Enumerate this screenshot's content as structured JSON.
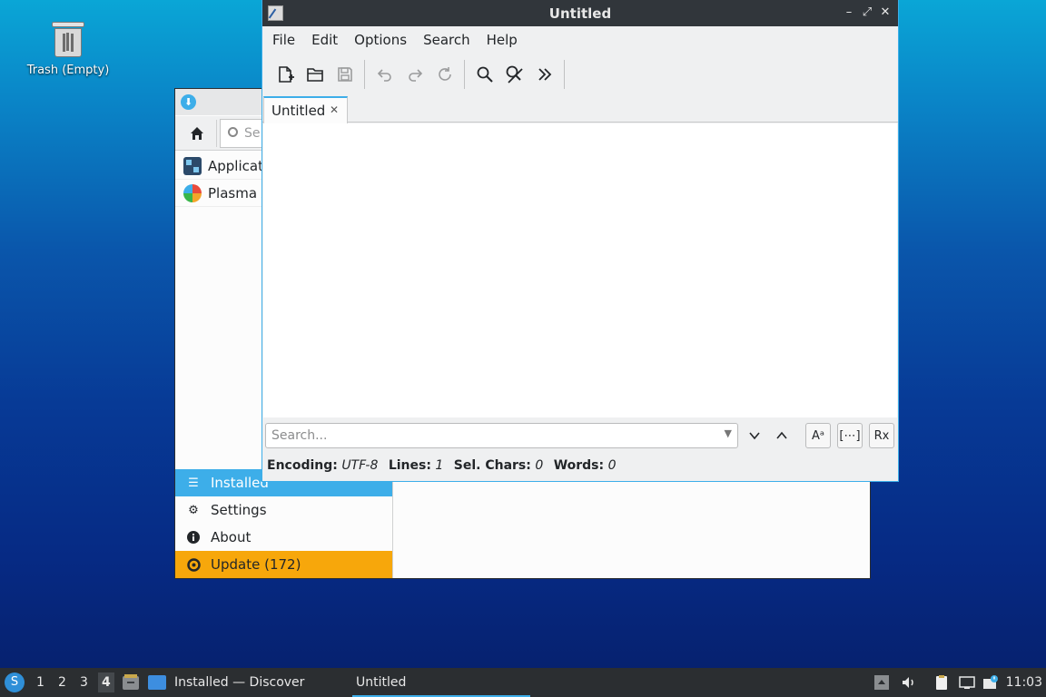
{
  "desktop": {
    "trash_label": "Trash (Empty)"
  },
  "discover": {
    "search_placeholder": "Se",
    "list": [
      {
        "label": "Applicati"
      },
      {
        "label": "Plasma A"
      }
    ],
    "nav": [
      {
        "label": "Installed",
        "icon": "list-icon"
      },
      {
        "label": "Settings",
        "icon": "gear-icon"
      },
      {
        "label": "About",
        "icon": "info-icon"
      },
      {
        "label": "Update (172)",
        "icon": "update-icon"
      }
    ],
    "colors": {
      "active": "#3daee9",
      "update": "#f7a70b"
    }
  },
  "editor": {
    "title": "Untitled",
    "menus": [
      "File",
      "Edit",
      "Options",
      "Search",
      "Help"
    ],
    "tab_label": "Untitled",
    "search_placeholder": "Search...",
    "status": {
      "encoding_label": "Encoding:",
      "encoding_value": "UTF-8",
      "lines_label": "Lines:",
      "lines_value": "1",
      "sel_label": "Sel. Chars:",
      "sel_value": "0",
      "words_label": "Words:",
      "words_value": "0"
    }
  },
  "taskbar": {
    "desktops": [
      "1",
      "2",
      "3",
      "4"
    ],
    "tasks": [
      {
        "label": "Installed — Discover"
      },
      {
        "label": "Untitled"
      }
    ],
    "clock": "11:03"
  }
}
